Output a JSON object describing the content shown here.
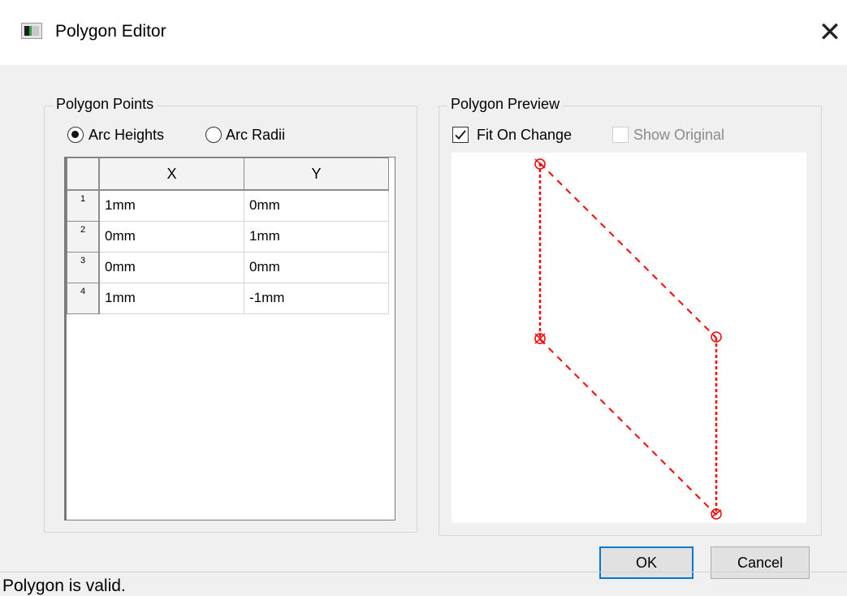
{
  "window": {
    "title": "Polygon Editor",
    "close_glyph": "✕"
  },
  "points_group": {
    "title": "Polygon Points",
    "mode_options": [
      {
        "label": "Arc Heights",
        "selected": true
      },
      {
        "label": "Arc Radii",
        "selected": false
      }
    ],
    "table": {
      "columns": [
        "X",
        "Y"
      ],
      "rows": [
        {
          "num": "1",
          "x": "1mm",
          "y": "0mm"
        },
        {
          "num": "2",
          "x": "0mm",
          "y": "1mm"
        },
        {
          "num": "3",
          "x": "0mm",
          "y": "0mm"
        },
        {
          "num": "4",
          "x": "1mm",
          "y": "-1mm"
        }
      ]
    }
  },
  "preview_group": {
    "title": "Polygon Preview",
    "fit_on_change": {
      "label": "Fit On Change",
      "checked": true,
      "enabled": true
    },
    "show_original": {
      "label": "Show Original",
      "checked": false,
      "enabled": false
    },
    "stroke_color": "#ff0000"
  },
  "buttons": {
    "ok": "OK",
    "cancel": "Cancel"
  },
  "status": {
    "text": "Polygon is valid."
  },
  "icons": {
    "app": "window-app-icon",
    "check": "checkmark-icon"
  }
}
